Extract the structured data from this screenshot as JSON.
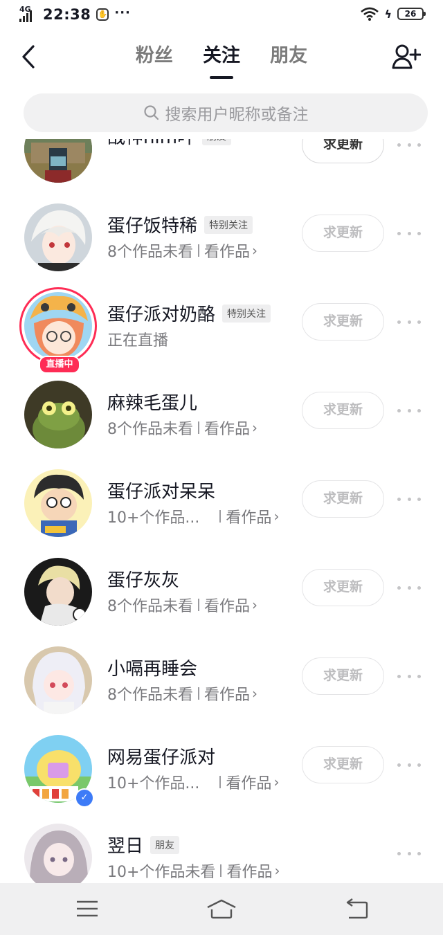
{
  "status_bar": {
    "network": "4G",
    "time": "22:38",
    "extra": "···",
    "battery": "26"
  },
  "header": {
    "tabs": [
      {
        "label": "粉丝",
        "active": false
      },
      {
        "label": "关注",
        "active": true
      },
      {
        "label": "朋友",
        "active": false
      }
    ]
  },
  "search": {
    "placeholder": "搜索用户昵称或备注"
  },
  "update_label": "求更新",
  "live_badge": "直播中",
  "users": [
    {
      "name": "战神him吖",
      "tag": "朋友",
      "sub_count": "",
      "sub_link": ""
    },
    {
      "name": "蛋仔饭特稀",
      "tag": "特别关注",
      "sub_count": "8个作品未看",
      "sub_link": "看作品"
    },
    {
      "name": "蛋仔派对奶酪",
      "tag": "特别关注",
      "status": "正在直播"
    },
    {
      "name": "麻辣毛蛋儿",
      "tag": "",
      "sub_count": "8个作品未看",
      "sub_link": "看作品"
    },
    {
      "name": "蛋仔派对呆呆",
      "tag": "",
      "sub_count": "10+个作品...",
      "sub_link": "看作品"
    },
    {
      "name": "蛋仔灰灰",
      "tag": "",
      "sub_count": "8个作品未看",
      "sub_link": "看作品"
    },
    {
      "name": "小嗝再睡会",
      "tag": "",
      "sub_count": "8个作品未看",
      "sub_link": "看作品"
    },
    {
      "name": "网易蛋仔派对",
      "tag": "",
      "sub_count": "10+个作品...",
      "sub_link": "看作品"
    },
    {
      "name": "翌日",
      "tag": "朋友",
      "sub_count": "10+个作品未看",
      "sub_link": "看作品"
    }
  ],
  "icons": {
    "back": "back-arrow-icon",
    "add_user": "add-user-icon",
    "search": "search-icon",
    "more": "more-dots-icon",
    "nav_menu": "menu-icon",
    "nav_home": "home-icon",
    "nav_back": "return-icon"
  },
  "colors": {
    "live": "#fe2c55",
    "verified": "#3d7bf7",
    "text_primary": "#161823",
    "text_secondary": "#7a7a7e"
  }
}
